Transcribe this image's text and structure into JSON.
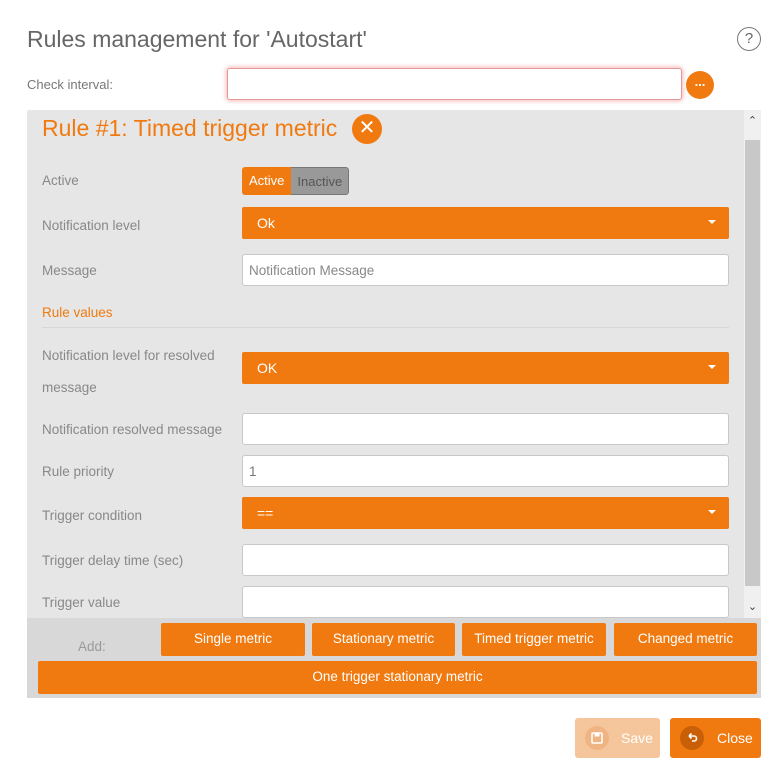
{
  "dialog": {
    "title": "Rules management for 'Autostart'",
    "help_icon": "?"
  },
  "check_interval": {
    "label": "Check interval:",
    "value": "",
    "button_label": "..."
  },
  "rule": {
    "title": "Rule #1: Timed trigger metric",
    "remove_icon": "✕",
    "active": {
      "label": "Active",
      "options": [
        "Active",
        "Inactive"
      ],
      "selected": "Active"
    },
    "notification_level": {
      "label": "Notification level",
      "value": "Ok"
    },
    "message": {
      "label": "Message",
      "value": "",
      "placeholder": "Notification Message"
    },
    "rule_values": {
      "section_title": "Rule values",
      "resolved_level": {
        "label": "Notification level for resolved message",
        "value": "OK"
      },
      "resolved_message": {
        "label": "Notification resolved message",
        "value": ""
      },
      "priority": {
        "label": "Rule priority",
        "value": "1"
      },
      "trigger_condition": {
        "label": "Trigger condition",
        "value": "=="
      },
      "trigger_delay": {
        "label": "Trigger delay time (sec)",
        "value": ""
      },
      "trigger_value": {
        "label": "Trigger value",
        "value": ""
      }
    }
  },
  "add_bar": {
    "label": "Add:",
    "buttons": [
      "Single metric",
      "Stationary metric",
      "Timed trigger metric",
      "Changed metric",
      "One trigger stationary metric"
    ]
  },
  "footer": {
    "save_label": "Save",
    "save_icon": "floppy-disk-icon",
    "close_label": "Close",
    "close_icon": "undo-arrow-icon"
  },
  "colors": {
    "accent": "#f07a10",
    "panel_bg": "#e6e6e6",
    "save_disabled": "#f5c69b"
  }
}
